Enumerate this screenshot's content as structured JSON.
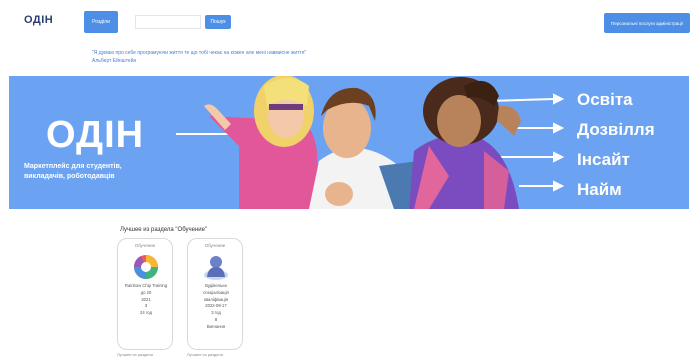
{
  "header": {
    "brand": "ОДІН",
    "sections_button": "Розділи",
    "search_placeholder": "",
    "search_button": "Пошук",
    "private_button": "Персональні послуги адміністрації"
  },
  "quote": {
    "text": "\"Я думаю про себе програмуючи життя те що тобі чекає на кожен але мені навмисне життя\"",
    "author": "Альберт Ейнштейн"
  },
  "hero": {
    "title": "ОДІН",
    "subtitle": "Маркетплейс для студентів, викладачів, роботодавців",
    "nav": [
      "Освіта",
      "Дозвілля",
      "Інсайт",
      "Найм"
    ],
    "colors": {
      "background": "#6ba3f2",
      "text": "#ffffff"
    }
  },
  "section": {
    "heading": "Лучшее из раздела \"Обучение\"",
    "cards": [
      {
        "label": "Обучение",
        "icon": "colorful-wheel-icon",
        "lines": [
          "Rainbow Chip Training",
          "до 20",
          "2021",
          "3",
          "24 год"
        ]
      },
      {
        "label": "Обучение",
        "icon": "blue-figure-icon",
        "lines": [
          "Будівельна",
          "спеціалізація",
          "кваліфікація",
          "2022-08-17",
          "3 год",
          "8",
          "Вигнання"
        ]
      }
    ]
  },
  "footer": {
    "fragments": [
      "Лучшее из раздела",
      "Лучшее из раздела"
    ]
  }
}
